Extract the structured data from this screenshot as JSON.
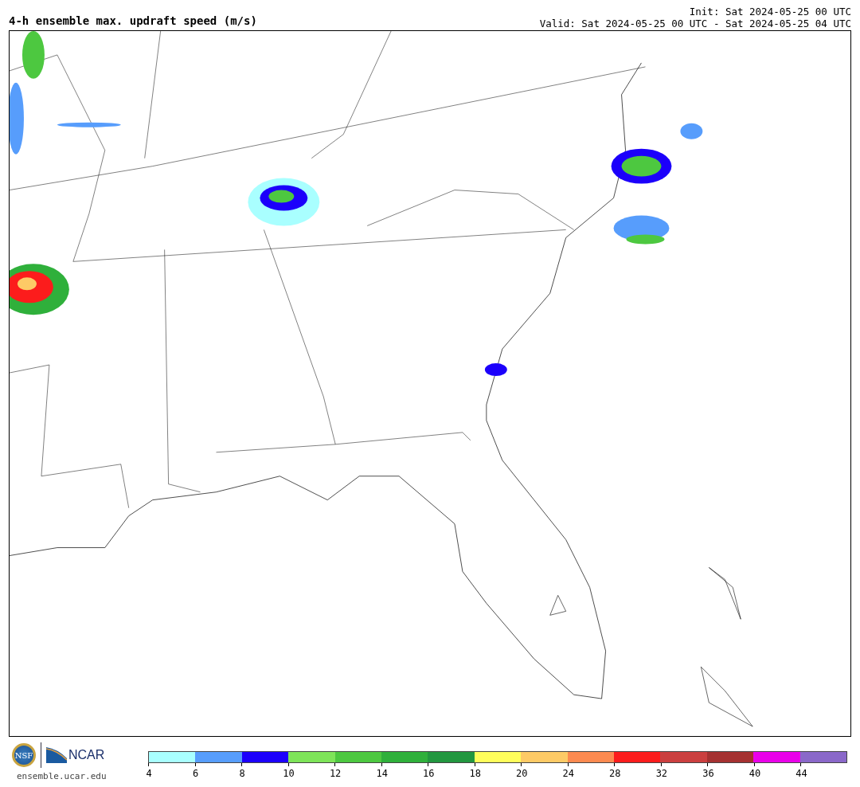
{
  "title": "4-h ensemble max. updraft speed (m/s)",
  "init": "Init: Sat 2024-05-25 00 UTC",
  "valid": "Valid: Sat 2024-05-25 00 UTC - Sat 2024-05-25 04 UTC",
  "logos": {
    "nsf": "NSF",
    "ncar": "NCAR"
  },
  "site": "ensemble.ucar.edu",
  "colorbar": {
    "segments": [
      {
        "color": "#a9ffff"
      },
      {
        "color": "#579dfc"
      },
      {
        "color": "#1c00fb"
      },
      {
        "color": "#7ee459"
      },
      {
        "color": "#4dc840"
      },
      {
        "color": "#2fb03b"
      },
      {
        "color": "#22973f"
      },
      {
        "color": "#fffe5b"
      },
      {
        "color": "#fdca66"
      },
      {
        "color": "#fc8a50"
      },
      {
        "color": "#fc1c1c"
      },
      {
        "color": "#cb3f3f"
      },
      {
        "color": "#a53131"
      },
      {
        "color": "#ea00ea"
      },
      {
        "color": "#8a68c9"
      }
    ],
    "ticks": [
      "4",
      "6",
      "8",
      "10",
      "12",
      "14",
      "16",
      "18",
      "20",
      "24",
      "28",
      "32",
      "36",
      "40",
      "44"
    ]
  }
}
